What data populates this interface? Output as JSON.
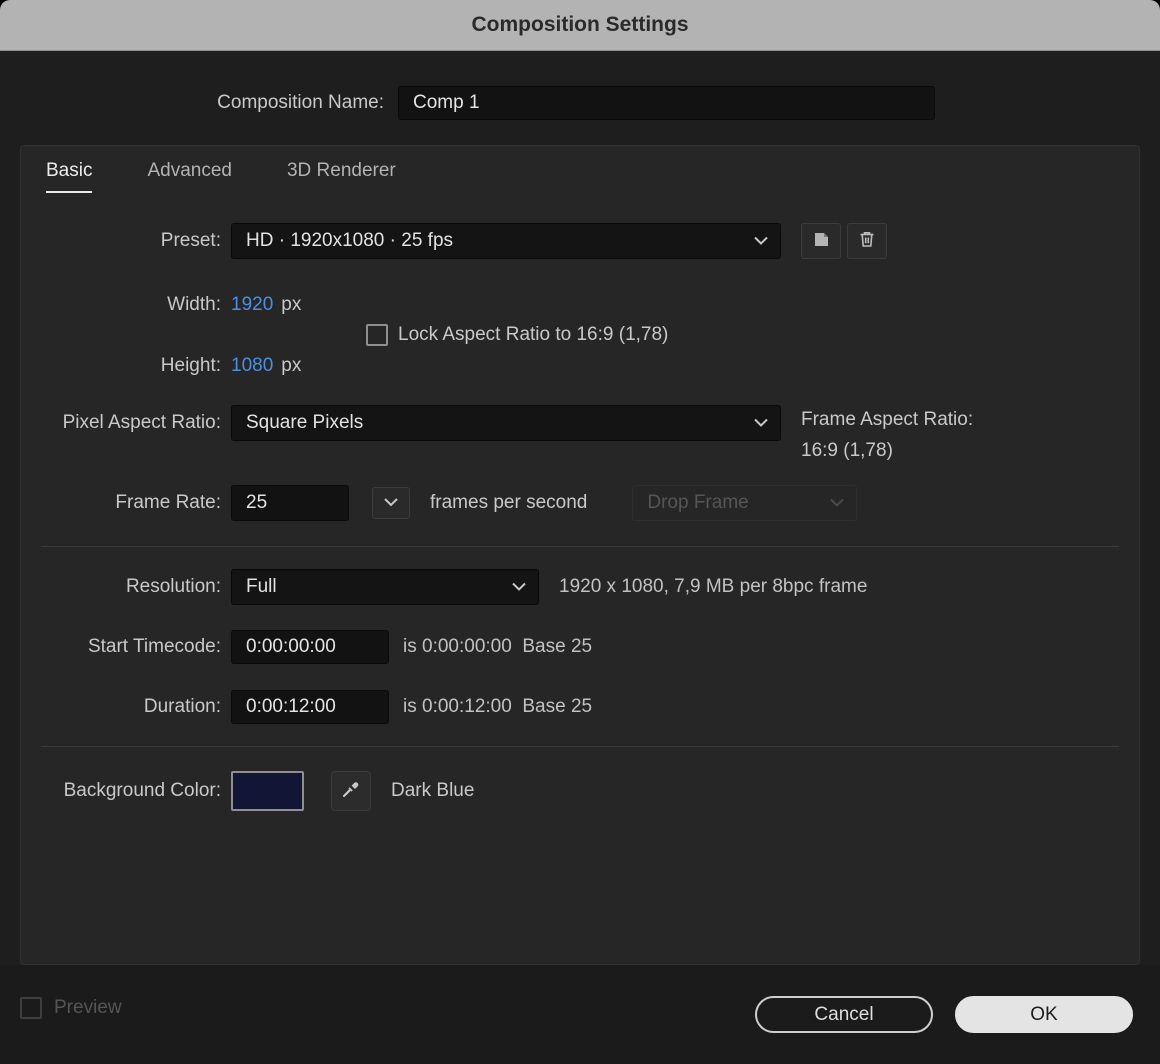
{
  "window": {
    "title": "Composition Settings"
  },
  "name": {
    "label": "Composition Name:",
    "value": "Comp 1"
  },
  "tabs": [
    {
      "label": "Basic",
      "active": true
    },
    {
      "label": "Advanced",
      "active": false
    },
    {
      "label": "3D Renderer",
      "active": false
    }
  ],
  "preset": {
    "label": "Preset:",
    "value": "HD  ·  1920x1080 · 25 fps"
  },
  "dimensions": {
    "width_label": "Width:",
    "width_value": "1920",
    "width_unit": "px",
    "height_label": "Height:",
    "height_value": "1080",
    "height_unit": "px",
    "lock_label": "Lock Aspect Ratio to 16:9 (1,78)",
    "lock_checked": false
  },
  "pixel_aspect_ratio": {
    "label": "Pixel Aspect Ratio:",
    "value": "Square Pixels"
  },
  "frame_aspect_ratio": {
    "label": "Frame Aspect Ratio:",
    "value": "16:9 (1,78)"
  },
  "frame_rate": {
    "label": "Frame Rate:",
    "value": "25",
    "suffix": "frames per second",
    "drop_frame_value": "Drop Frame",
    "drop_frame_disabled": true
  },
  "resolution": {
    "label": "Resolution:",
    "value": "Full",
    "info": "1920 x 1080, 7,9 MB per 8bpc frame"
  },
  "start_timecode": {
    "label": "Start Timecode:",
    "value": "0:00:00:00",
    "info": "is 0:00:00:00  Base 25"
  },
  "duration": {
    "label": "Duration:",
    "value": "0:00:12:00",
    "info": "is 0:00:12:00  Base 25"
  },
  "background_color": {
    "label": "Background Color:",
    "swatch_color": "#131536",
    "name": "Dark Blue"
  },
  "footer": {
    "preview_label": "Preview",
    "cancel_label": "Cancel",
    "ok_label": "OK"
  },
  "colors": {
    "accent_blue": "#4a90e2",
    "title_bar": "#b3b3b3",
    "dialog_bg": "#1e1e1e",
    "panel_bg": "#262626"
  }
}
